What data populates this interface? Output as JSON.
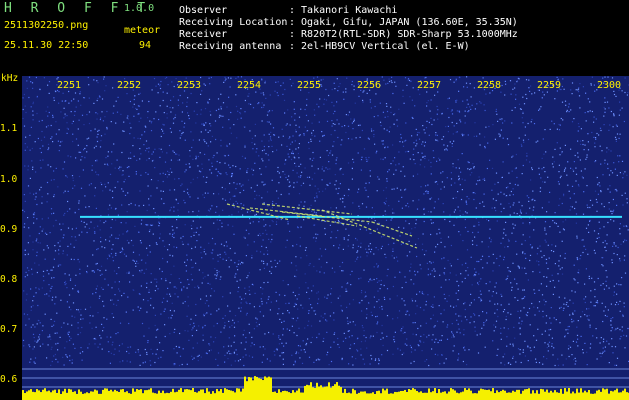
{
  "header": {
    "logo": "H R O F F T",
    "version": "1.0.0",
    "filename": "2511302250.png",
    "datetime": "25.11.30 22:50",
    "meteor_label": "meteor",
    "meteor_count": "94",
    "info": [
      {
        "label": "Observer",
        "value": ": Takanori Kawachi"
      },
      {
        "label": "Receiving Location",
        "value": ": Ogaki, Gifu, JAPAN (136.60E, 35.35N)"
      },
      {
        "label": "Receiver",
        "value": ": R820T2(RTL-SDR) SDR-Sharp 53.1000MHz"
      },
      {
        "label": "Receiving antenna",
        "value": ": 2el-HB9CV Vertical (el. E-W)"
      }
    ]
  },
  "colors": {
    "background": "#000000",
    "spectrogram": "#14206e",
    "noise": "#3a58d6",
    "carrier": "#36e0ff",
    "axis_text": "#fff200",
    "header_green": "#7fe07f",
    "header_white": "#ffffff"
  },
  "chart_data": {
    "type": "heatmap",
    "y_unit_label": "kHz",
    "x_ticks": [
      "2251",
      "2252",
      "2253",
      "2254",
      "2255",
      "2256",
      "2257",
      "2258",
      "2259",
      "2300"
    ],
    "y_ticks": [
      "1.1",
      "1.0",
      "0.9",
      "0.8",
      "0.7",
      "0.6"
    ],
    "carrier_khz": 0.925,
    "carrier_time_range": [
      "2251",
      "2300"
    ]
  }
}
